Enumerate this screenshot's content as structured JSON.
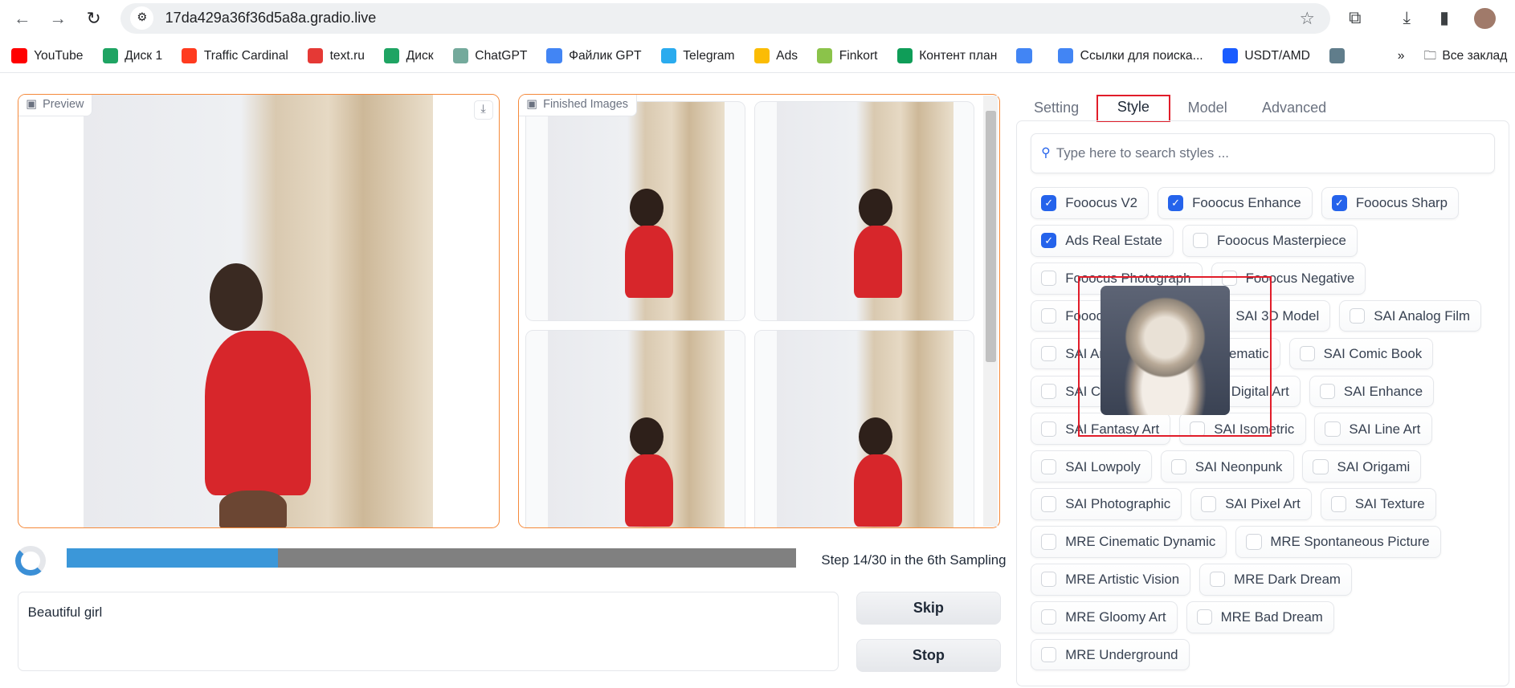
{
  "browser": {
    "url": "17da429a36f36d5a8a.gradio.live",
    "bookmarks": [
      {
        "label": "YouTube",
        "icon": "youtube-icon",
        "color": "#ff0000"
      },
      {
        "label": "Диск 1",
        "icon": "google-drive-icon",
        "color": "#1fa463"
      },
      {
        "label": "Traffic Cardinal",
        "icon": "traffic-cardinal-icon",
        "color": "#ff3b1f"
      },
      {
        "label": "text.ru",
        "icon": "textru-icon",
        "color": "#e53935"
      },
      {
        "label": "Диск",
        "icon": "google-drive-icon",
        "color": "#1fa463"
      },
      {
        "label": "ChatGPT",
        "icon": "chatgpt-icon",
        "color": "#74aa9c"
      },
      {
        "label": "Файлик GPT",
        "icon": "google-docs-icon",
        "color": "#4285f4"
      },
      {
        "label": "Telegram",
        "icon": "telegram-icon",
        "color": "#2aabee"
      },
      {
        "label": "Ads",
        "icon": "google-ads-icon",
        "color": "#fbbc04"
      },
      {
        "label": "Finkort",
        "icon": "finkort-icon",
        "color": "#8bc34a"
      },
      {
        "label": "Контент план",
        "icon": "google-sheets-icon",
        "color": "#0f9d58"
      },
      {
        "label": "",
        "icon": "google-translate-icon",
        "color": "#4285f4"
      },
      {
        "label": "Ссылки для поиска...",
        "icon": "google-docs-icon",
        "color": "#4285f4"
      },
      {
        "label": "USDT/AMD",
        "icon": "coin-icon",
        "color": "#1a5cff"
      },
      {
        "label": "",
        "icon": "sail-icon",
        "color": "#607d8b"
      }
    ],
    "more": "»",
    "all_bookmarks": "Все заклад"
  },
  "preview": {
    "label": "Preview"
  },
  "gallery": {
    "label": "Finished Images",
    "count": 4
  },
  "progress": {
    "fraction": 0.29,
    "text": "Step 14/30 in the 6th Sampling"
  },
  "prompt": {
    "value": "Beautiful girl"
  },
  "buttons": {
    "skip": "Skip",
    "stop": "Stop"
  },
  "tabs": [
    {
      "label": "Setting"
    },
    {
      "label": "Style",
      "selected": true
    },
    {
      "label": "Model"
    },
    {
      "label": "Advanced"
    }
  ],
  "styles": {
    "search_placeholder": "Type here to search styles ...",
    "items": [
      {
        "label": "Fooocus V2",
        "checked": true
      },
      {
        "label": "Fooocus Enhance",
        "checked": true
      },
      {
        "label": "Fooocus Sharp",
        "checked": true
      },
      {
        "label": "Ads Real Estate",
        "checked": true
      },
      {
        "label": "Fooocus Masterpiece",
        "checked": false
      },
      {
        "label": "Fooocus Photograph",
        "checked": false
      },
      {
        "label": "Fooocus Negative",
        "checked": false
      },
      {
        "label": "Fooocus Cinematic",
        "checked": false
      },
      {
        "label": "SAI 3D Model",
        "checked": false
      },
      {
        "label": "SAI Analog Film",
        "checked": false
      },
      {
        "label": "SAI Anime",
        "checked": false
      },
      {
        "label": "SAI Cinematic",
        "checked": false
      },
      {
        "label": "SAI Comic Book",
        "checked": false
      },
      {
        "label": "SAI Craft Clay",
        "checked": false
      },
      {
        "label": "SAI Digital Art",
        "checked": false
      },
      {
        "label": "SAI Enhance",
        "checked": false
      },
      {
        "label": "SAI Fantasy Art",
        "checked": false
      },
      {
        "label": "SAI Isometric",
        "checked": false
      },
      {
        "label": "SAI Line Art",
        "checked": false
      },
      {
        "label": "SAI Lowpoly",
        "checked": false
      },
      {
        "label": "SAI Neonpunk",
        "checked": false
      },
      {
        "label": "SAI Origami",
        "checked": false
      },
      {
        "label": "SAI Photographic",
        "checked": false
      },
      {
        "label": "SAI Pixel Art",
        "checked": false
      },
      {
        "label": "SAI Texture",
        "checked": false
      },
      {
        "label": "MRE Cinematic Dynamic",
        "checked": false
      },
      {
        "label": "MRE Spontaneous Picture",
        "checked": false
      },
      {
        "label": "MRE Artistic Vision",
        "checked": false
      },
      {
        "label": "MRE Dark Dream",
        "checked": false
      },
      {
        "label": "MRE Gloomy Art",
        "checked": false
      },
      {
        "label": "MRE Bad Dream",
        "checked": false
      },
      {
        "label": "MRE Underground",
        "checked": false
      }
    ]
  },
  "colors": {
    "accent": "#2563eb",
    "panel_border": "#f5893a",
    "highlight": "#e11d2a",
    "progress": "#3b97d9"
  }
}
